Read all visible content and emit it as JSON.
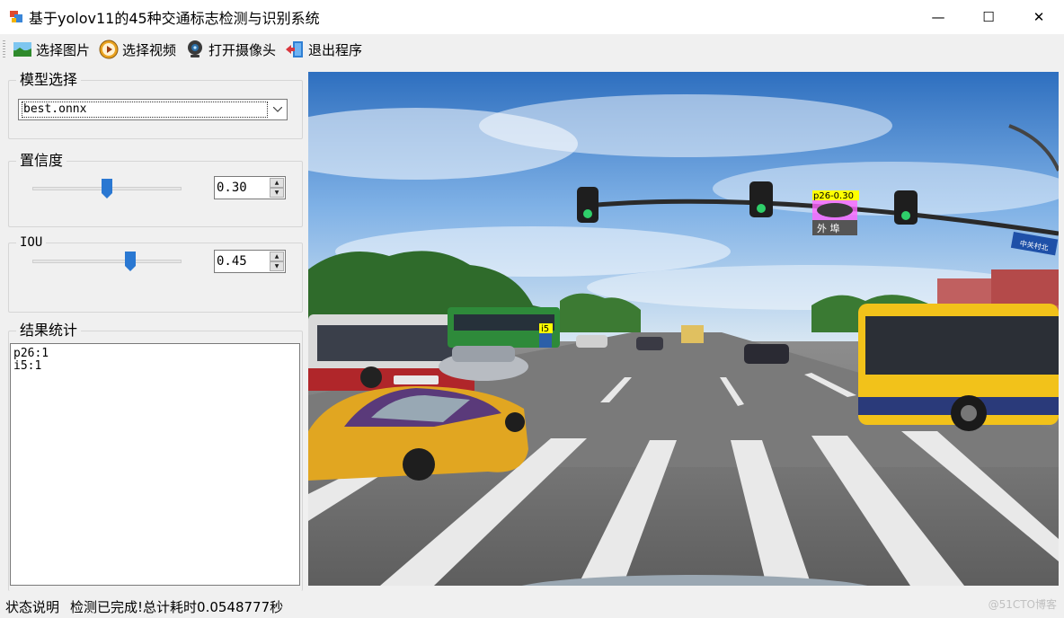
{
  "window": {
    "title": "基于yolov11的45种交通标志检测与识别系统",
    "controls": {
      "minimize": "—",
      "maximize": "☐",
      "close": "✕"
    }
  },
  "toolbar": {
    "items": [
      {
        "label": "选择图片",
        "icon": "picture-icon"
      },
      {
        "label": "选择视频",
        "icon": "play-icon"
      },
      {
        "label": "打开摄像头",
        "icon": "webcam-icon"
      },
      {
        "label": "退出程序",
        "icon": "exit-icon"
      }
    ]
  },
  "model": {
    "group_label": "模型选择",
    "selected": "best.onnx"
  },
  "confidence": {
    "group_label": "置信度",
    "value": "0.30",
    "fraction": 0.3
  },
  "iou": {
    "group_label": "IOU",
    "value": "0.45",
    "fraction": 0.45
  },
  "results": {
    "group_label": "结果统计",
    "lines": [
      "p26:1",
      "i5:1"
    ]
  },
  "detections": [
    {
      "label": "p26-0.30",
      "sign_text": "外 埠"
    },
    {
      "label": "i5"
    }
  ],
  "street_sign": "中关村北",
  "status": {
    "label": "状态说明",
    "message": "检测已完成!总计耗时0.0548777秒"
  },
  "watermark": "@51CTO博客",
  "colors": {
    "slider_thumb": "#2a78d2",
    "bus_yellow": "#f2c21a",
    "detection_box": "#ff66ff",
    "label_bg": "#ffff00"
  }
}
